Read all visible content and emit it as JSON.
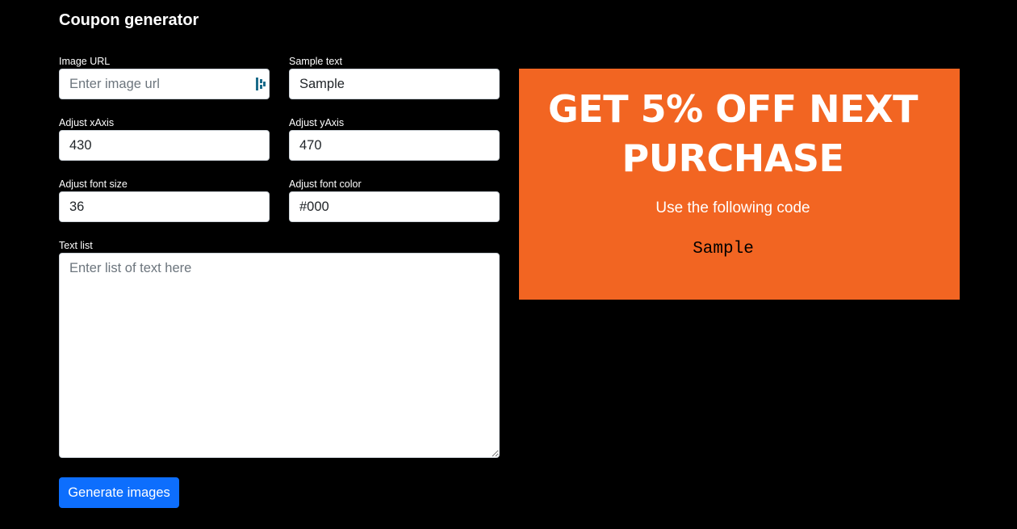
{
  "page": {
    "title": "Coupon generator"
  },
  "form": {
    "image_url": {
      "label": "Image URL",
      "value": "",
      "placeholder": "Enter image url"
    },
    "sample_text": {
      "label": "Sample text",
      "value": "Sample"
    },
    "x_axis": {
      "label": "Adjust xAxis",
      "value": "430"
    },
    "y_axis": {
      "label": "Adjust yAxis",
      "value": "470"
    },
    "font_size": {
      "label": "Adjust font size",
      "value": "36"
    },
    "font_color": {
      "label": "Adjust font color",
      "value": "#000"
    },
    "text_list": {
      "label": "Text list",
      "value": "",
      "placeholder": "Enter list of text here"
    },
    "generate_button_label": "Generate images"
  },
  "preview": {
    "headline_line1": "GET 5% OFF NEXT",
    "headline_line2": "PURCHASE",
    "subtext": "Use the following code",
    "code": "Sample",
    "background_color": "#f26522",
    "text_color": "#ffffff",
    "code_color": "#000000"
  },
  "colors": {
    "page_background": "#000000",
    "primary_button": "#0d6efd"
  }
}
